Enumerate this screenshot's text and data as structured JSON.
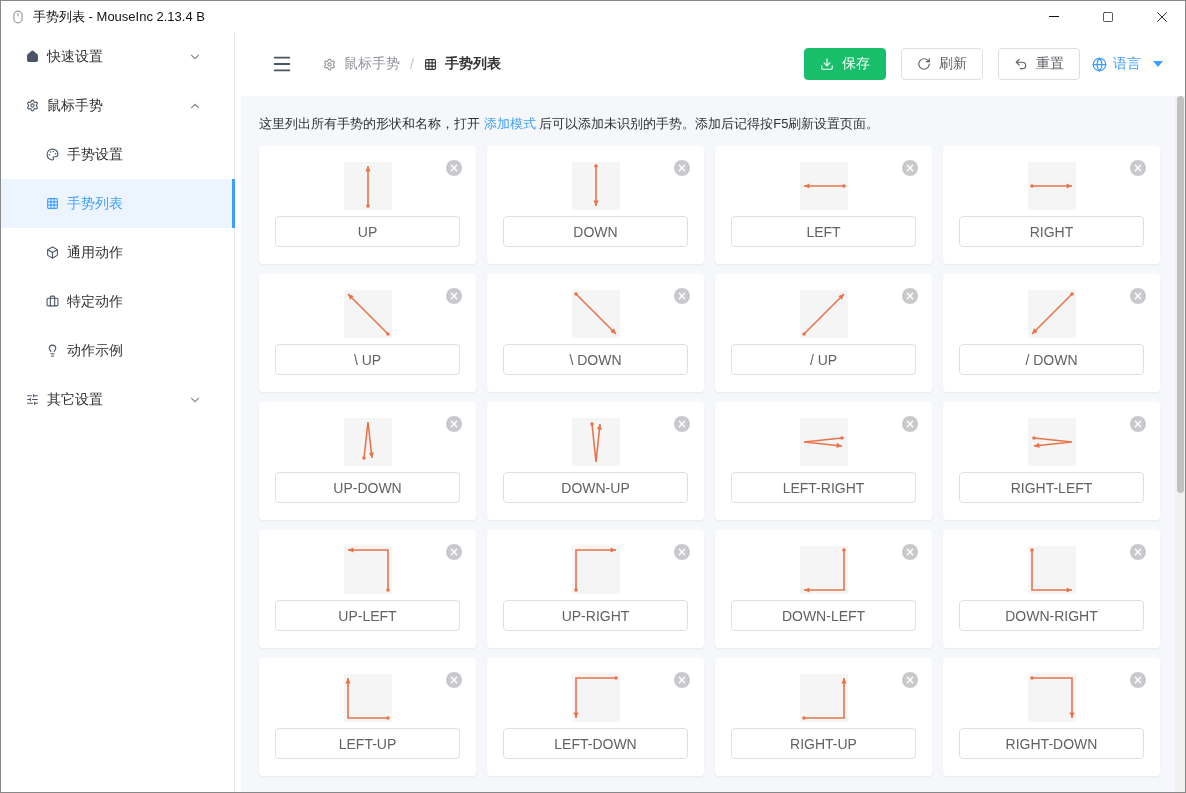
{
  "window": {
    "title": "手势列表 - MouseInc 2.13.4 B"
  },
  "sidebar": {
    "items": [
      {
        "label": "快速设置",
        "expanded": false,
        "selected": false
      },
      {
        "label": "鼠标手势",
        "expanded": true,
        "selected": false,
        "children": [
          {
            "label": "手势设置",
            "selected": false
          },
          {
            "label": "手势列表",
            "selected": true
          },
          {
            "label": "通用动作",
            "selected": false
          },
          {
            "label": "特定动作",
            "selected": false
          },
          {
            "label": "动作示例",
            "selected": false
          }
        ]
      },
      {
        "label": "其它设置",
        "expanded": false,
        "selected": false
      }
    ]
  },
  "breadcrumb_separator": "/",
  "breadcrumb": [
    {
      "label": "鼠标手势",
      "current": false
    },
    {
      "label": "手势列表",
      "current": true
    }
  ],
  "buttons": [
    {
      "label": "保存",
      "kind": "primary"
    },
    {
      "label": "刷新",
      "kind": "plain"
    },
    {
      "label": "重置",
      "kind": "plain"
    },
    {
      "label": "语言",
      "kind": "dropdown"
    }
  ],
  "notice": {
    "before": "这里列出所有手势的形状和名称，打开 ",
    "link": "添加模式",
    "after": " 后可以添加未识别的手势。添加后记得按F5刷新设置页面。"
  },
  "gestures": [
    {
      "name": "UP",
      "kind": "up"
    },
    {
      "name": "DOWN",
      "kind": "down"
    },
    {
      "name": "LEFT",
      "kind": "left"
    },
    {
      "name": "RIGHT",
      "kind": "right"
    },
    {
      "name": "\\ UP",
      "kind": "nwup"
    },
    {
      "name": "\\ DOWN",
      "kind": "sedown"
    },
    {
      "name": "/ UP",
      "kind": "neup"
    },
    {
      "name": "/ DOWN",
      "kind": "swdown"
    },
    {
      "name": "UP-DOWN",
      "kind": "updown"
    },
    {
      "name": "DOWN-UP",
      "kind": "downup"
    },
    {
      "name": "LEFT-RIGHT",
      "kind": "leftright"
    },
    {
      "name": "RIGHT-LEFT",
      "kind": "rightleft"
    },
    {
      "name": "UP-LEFT",
      "kind": "upleft"
    },
    {
      "name": "UP-RIGHT",
      "kind": "upright"
    },
    {
      "name": "DOWN-LEFT",
      "kind": "downleft"
    },
    {
      "name": "DOWN-RIGHT",
      "kind": "downright"
    },
    {
      "name": "LEFT-UP",
      "kind": "leftup"
    },
    {
      "name": "LEFT-DOWN",
      "kind": "leftdown"
    },
    {
      "name": "RIGHT-UP",
      "kind": "rightup"
    },
    {
      "name": "RIGHT-DOWN",
      "kind": "rightdown"
    }
  ]
}
